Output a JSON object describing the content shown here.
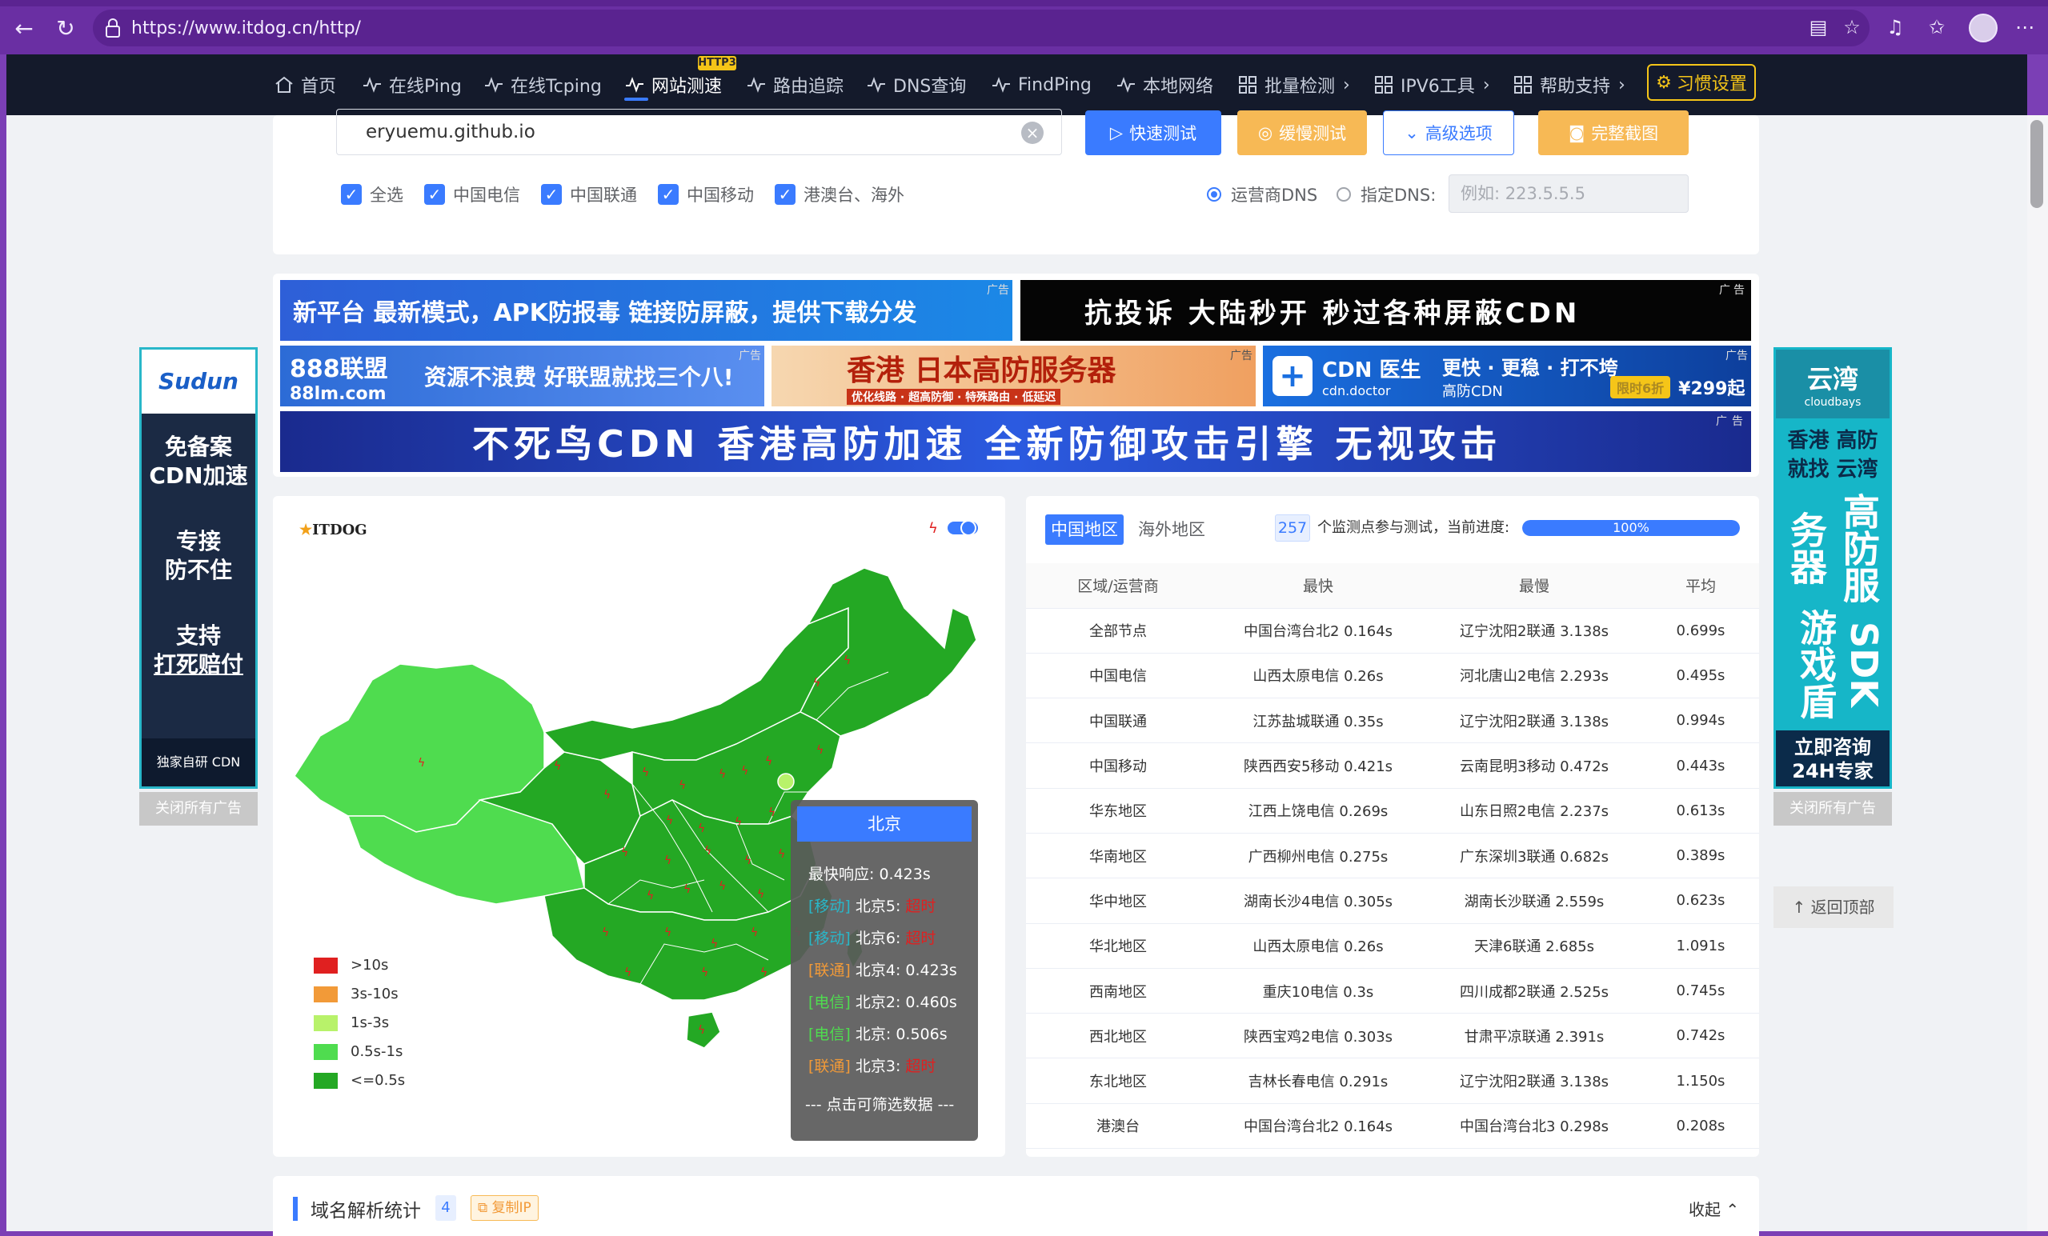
{
  "browser": {
    "url": "https://www.itdog.cn/http/"
  },
  "nav": {
    "items": [
      {
        "label": "首页",
        "icon": "home-icon"
      },
      {
        "label": "在线Ping",
        "icon": "pulse-icon"
      },
      {
        "label": "在线Tcping",
        "icon": "pulse-icon"
      },
      {
        "label": "网站测速",
        "icon": "pulse-icon",
        "active": true,
        "badge": "HTTP3"
      },
      {
        "label": "路由追踪",
        "icon": "pulse-icon"
      },
      {
        "label": "DNS查询",
        "icon": "pulse-icon"
      },
      {
        "label": "FindPing",
        "icon": "pulse-icon"
      },
      {
        "label": "本地网络",
        "icon": "pulse-icon"
      },
      {
        "label": "批量检测",
        "icon": "grid-icon",
        "chevron": "›"
      },
      {
        "label": "IPV6工具",
        "icon": "grid-icon",
        "chevron": "›"
      },
      {
        "label": "帮助支持",
        "icon": "grid-icon",
        "chevron": "›"
      }
    ],
    "habit_button": "习惯设置"
  },
  "search": {
    "value": "eryuemu.github.io",
    "quick_test": "快速测试",
    "slow_test": "缓慢测试",
    "advanced": "高级选项",
    "screenshot": "完整截图",
    "checkboxes": [
      "全选",
      "中国电信",
      "中国联通",
      "中国移动",
      "港澳台、海外"
    ],
    "radio_isp_dns": "运营商DNS",
    "radio_custom_dns": "指定DNS:",
    "dns_placeholder": "例如: 223.5.5.5"
  },
  "ads": {
    "tag": "广告",
    "banner1": "新平台  最新模式，APK防报毒  链接防屏蔽，提供下载分发",
    "banner2": "抗投诉  大陆秒开  秒过各种屏蔽CDN",
    "banner3_logo": "888联盟",
    "banner3_sub": "88lm.com",
    "banner3_text": "资源不浪费 好联盟就找三个八!",
    "banner4": "香港 日本高防服务器",
    "banner4_sub": "优化线路 · 超高防御 · 特殊路由 · 低延迟",
    "banner5_title": "CDN 医生",
    "banner5_sub": "cdn.doctor",
    "banner5_text1": "更快 · 更稳 · 打不垮",
    "banner5_text2": "高防CDN",
    "banner5_discount": "限时6折",
    "banner5_price": "¥299起",
    "banner6": "不死鸟CDN  香港高防加速  全新防御攻击引擎  无视攻击",
    "left_ad": {
      "brand": "Sudun",
      "line1": "免备案",
      "line2": "CDN加速",
      "line3": "专接",
      "line4": "防不住",
      "line5": "支持",
      "line6": "打死赔付",
      "footer": "独家自研 CDN"
    },
    "right_ad": {
      "brand": "云湾",
      "brand_sub": "cloudbays",
      "line1": "香港 高防",
      "line2": "就找 云湾",
      "col1": "高防服务器",
      "col2": "SDK游戏盾",
      "footer": "立即咨询 24H专家"
    },
    "close_all": "关闭所有广告",
    "back_to_top": "返回顶部"
  },
  "map": {
    "logo": "ITDOG",
    "legend": [
      {
        "label": ">10s",
        "color": "#e02020"
      },
      {
        "label": "3s-10s",
        "color": "#f29a38"
      },
      {
        "label": "1s-3s",
        "color": "#b8f26a"
      },
      {
        "label": "0.5s-1s",
        "color": "#4fdc4f"
      },
      {
        "label": "<=0.5s",
        "color": "#24a824"
      }
    ],
    "tooltip": {
      "title": "北京",
      "fastest": "最快响应: 0.423s",
      "lines": [
        {
          "isp": "[移动]",
          "node": "北京5:",
          "value": "超时"
        },
        {
          "isp": "[移动]",
          "node": "北京6:",
          "value": "超时"
        },
        {
          "isp": "[联通]",
          "node": "北京4:",
          "value": "0.423s"
        },
        {
          "isp": "[电信]",
          "node": "北京2:",
          "value": "0.460s"
        },
        {
          "isp": "[电信]",
          "node": "北京:",
          "value": "0.506s"
        },
        {
          "isp": "[联通]",
          "node": "北京3:",
          "value": "超时"
        }
      ],
      "footer": "--- 点击可筛选数据 ---"
    }
  },
  "results": {
    "tab_china": "中国地区",
    "tab_overseas": "海外地区",
    "node_count": "257",
    "progress_text": "个监测点参与测试，当前进度:",
    "progress_value": "100%",
    "progress_fraction": 1.0,
    "columns": [
      "区域/运营商",
      "最快",
      "最慢",
      "平均"
    ],
    "rows": [
      [
        "全部节点",
        "中国台湾台北2 0.164s",
        "辽宁沈阳2联通 3.138s",
        "0.699s"
      ],
      [
        "中国电信",
        "山西太原电信 0.26s",
        "河北唐山2电信 2.293s",
        "0.495s"
      ],
      [
        "中国联通",
        "江苏盐城联通 0.35s",
        "辽宁沈阳2联通 3.138s",
        "0.994s"
      ],
      [
        "中国移动",
        "陕西西安5移动 0.421s",
        "云南昆明3移动 0.472s",
        "0.443s"
      ],
      [
        "华东地区",
        "江西上饶电信 0.269s",
        "山东日照2电信 2.237s",
        "0.613s"
      ],
      [
        "华南地区",
        "广西柳州电信 0.275s",
        "广东深圳3联通 0.682s",
        "0.389s"
      ],
      [
        "华中地区",
        "湖南长沙4电信 0.305s",
        "湖南长沙联通 2.559s",
        "0.623s"
      ],
      [
        "华北地区",
        "山西太原电信 0.26s",
        "天津6联通 2.685s",
        "1.091s"
      ],
      [
        "西南地区",
        "重庆10电信 0.3s",
        "四川成都2联通 2.525s",
        "0.745s"
      ],
      [
        "西北地区",
        "陕西宝鸡2电信 0.303s",
        "甘肃平凉联通 2.391s",
        "0.742s"
      ],
      [
        "东北地区",
        "吉林长春电信 0.291s",
        "辽宁沈阳2联通 3.138s",
        "1.150s"
      ],
      [
        "港澳台",
        "中国台湾台北2 0.164s",
        "中国台湾台北3 0.298s",
        "0.208s"
      ]
    ]
  },
  "domain_stats": {
    "title": "域名解析统计",
    "count": "4",
    "copy_ip": "复制IP",
    "collapse": "收起"
  },
  "colors": {
    "accent": "#3a7bff",
    "nav_bg": "#141a2b",
    "browser_bg": "#6a2fa3",
    "timeout": "#e02020",
    "slow_button": "#f7b955"
  }
}
